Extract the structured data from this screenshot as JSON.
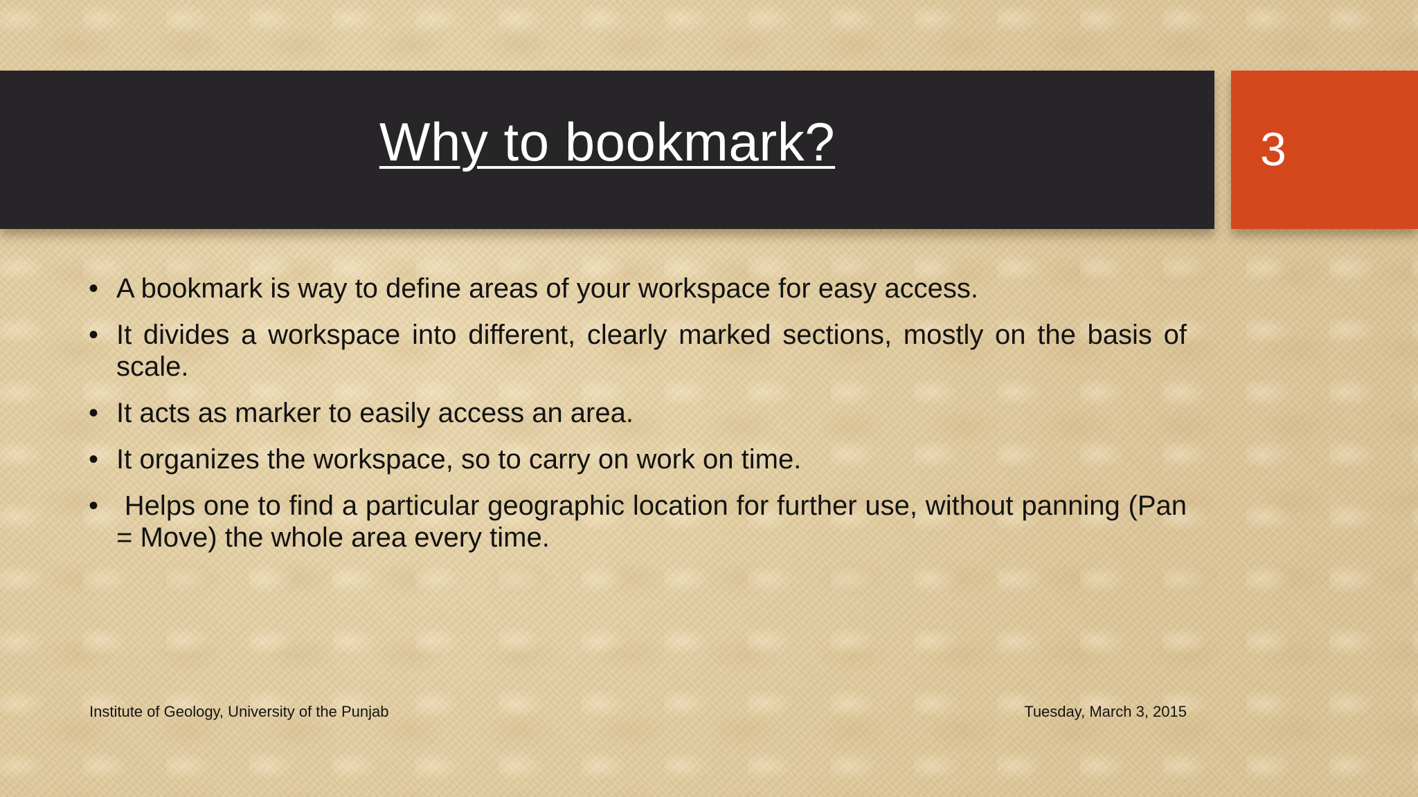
{
  "slide": {
    "title": "Why to bookmark?",
    "number": "3",
    "bullet_symbol": "•",
    "bullets": [
      "A bookmark is way to define areas of your workspace for easy access.",
      "It divides a workspace into different, clearly marked sections, mostly on the basis of scale.",
      "It acts as marker to easily access an area.",
      "It organizes the workspace, so to carry on work on time.",
      " Helps one to find a particular geographic location for further use, without panning (Pan = Move) the whole area every time."
    ],
    "footer_left": "Institute of Geology, University of the Punjab",
    "footer_right": "Tuesday, March 3, 2015"
  },
  "colors": {
    "title_bar": "#272527",
    "number_box": "#d4471c",
    "background": "#e2cfa6"
  }
}
